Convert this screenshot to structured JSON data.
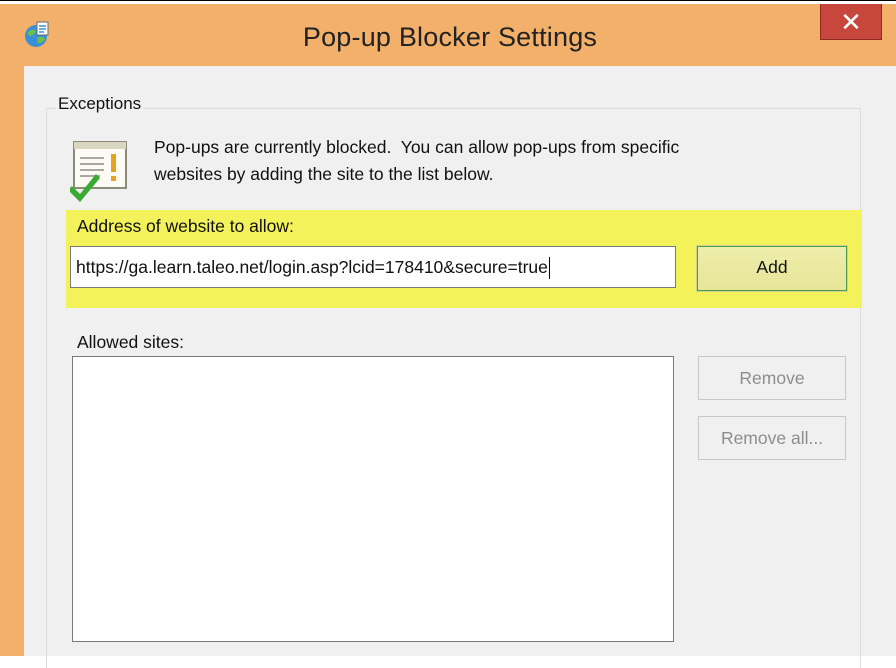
{
  "window": {
    "title": "Pop-up Blocker Settings",
    "close_glyph": "✕",
    "icon": "ie-globe-icon"
  },
  "exceptions": {
    "group_label": "Exceptions",
    "info_line1": "Pop-ups are currently blocked.  You can allow pop-ups from specific",
    "info_line2": "websites by adding the site to the list below.",
    "info_icon": "document-checkmark-icon"
  },
  "address": {
    "label": "Address of website to allow:",
    "value": "https://ga.learn.taleo.net/login.asp?lcid=178410&secure=true",
    "add_label": "Add"
  },
  "allowed": {
    "label": "Allowed sites:",
    "sites": [],
    "remove_label": "Remove",
    "remove_all_label": "Remove all..."
  },
  "colors": {
    "frame": "#f2b06a",
    "close": "#c7473c",
    "highlight": "#f3f25a",
    "client": "#f0f0f0"
  }
}
